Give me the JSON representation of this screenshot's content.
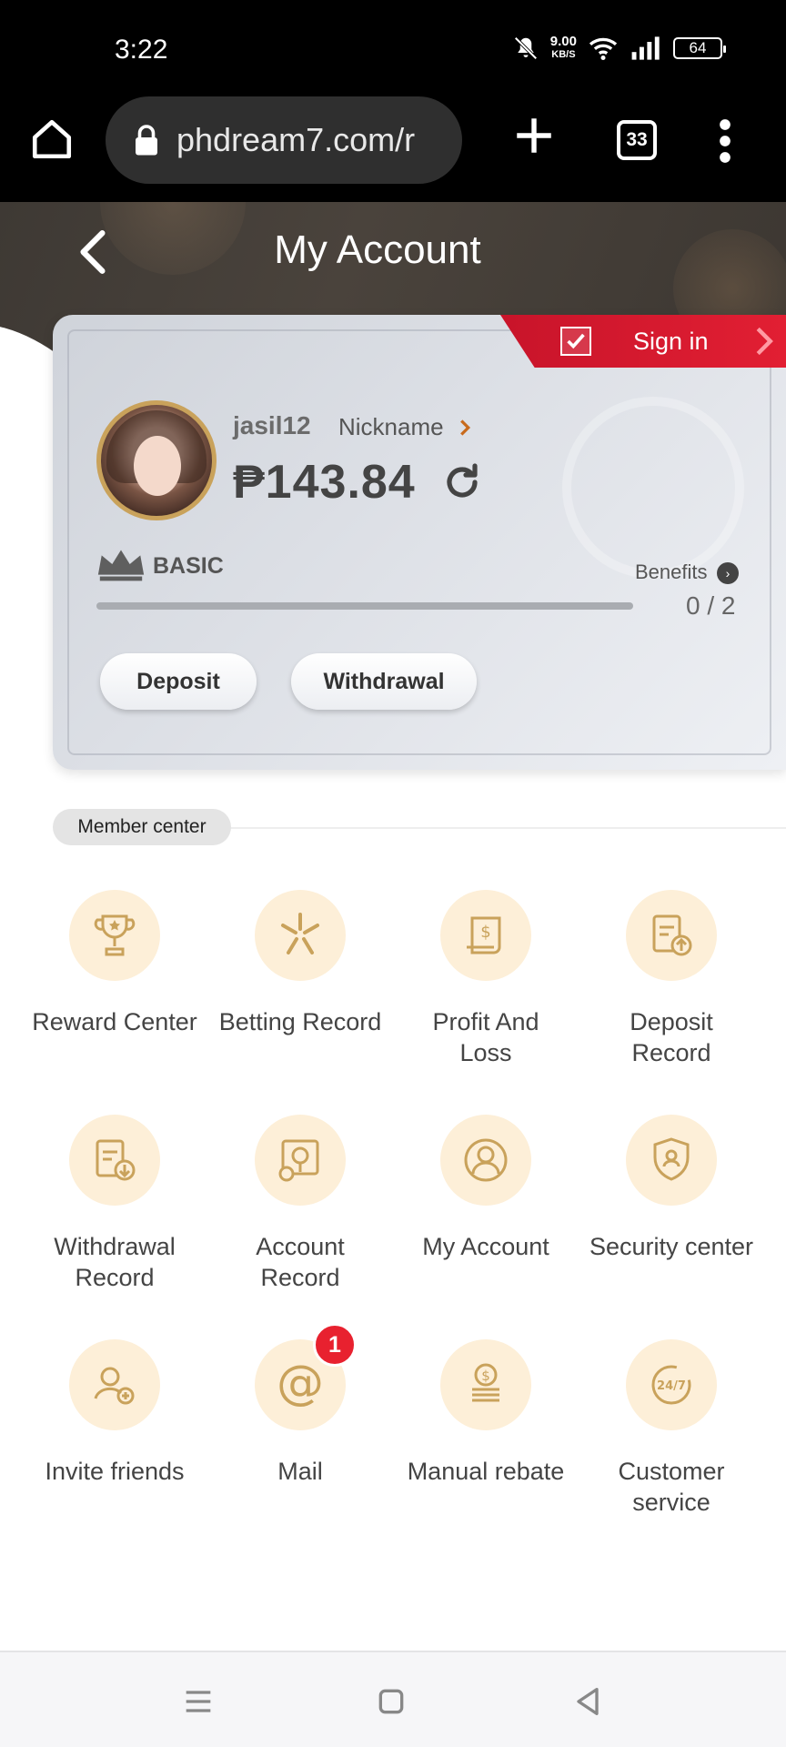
{
  "status_bar": {
    "time": "3:22",
    "net_speed_value": "9.00",
    "net_speed_unit": "KB/S",
    "battery": "64"
  },
  "browser": {
    "url": "phdream7.com/r",
    "tab_count": "33"
  },
  "header": {
    "title": "My Account"
  },
  "account": {
    "sign_in_label": "Sign in",
    "username": "jasil12",
    "nickname_label": "Nickname",
    "balance": "₱143.84",
    "vip_level": "BASIC",
    "benefits_label": "Benefits",
    "progress_text": "0 / 2",
    "progress_fraction": 0,
    "deposit_label": "Deposit",
    "withdrawal_label": "Withdrawal"
  },
  "member_center": {
    "section_label": "Member center",
    "items": [
      {
        "label": "Reward Center",
        "icon": "trophy-icon"
      },
      {
        "label": "Betting Record",
        "icon": "sparkle-icon"
      },
      {
        "label": "Profit And\nLoss",
        "icon": "receipt-icon"
      },
      {
        "label": "Deposit\nRecord",
        "icon": "clipboard-upload-icon"
      },
      {
        "label": "Withdrawal\nRecord",
        "icon": "clipboard-download-icon"
      },
      {
        "label": "Account\nRecord",
        "icon": "search-document-icon"
      },
      {
        "label": "My Account",
        "icon": "user-icon"
      },
      {
        "label": "Security center",
        "icon": "shield-user-icon"
      },
      {
        "label": "Invite friends",
        "icon": "add-user-icon"
      },
      {
        "label": "Mail",
        "icon": "at-sign-icon",
        "badge": "1"
      },
      {
        "label": "Manual rebate",
        "icon": "coins-icon"
      },
      {
        "label": "Customer\nservice",
        "icon": "support-24-7-icon"
      }
    ]
  },
  "colors": {
    "icon_gold": "#c9a25b",
    "icon_bg": "#fdefd8",
    "ribbon_red": "#d81a2e",
    "badge_red": "#e8212f"
  }
}
